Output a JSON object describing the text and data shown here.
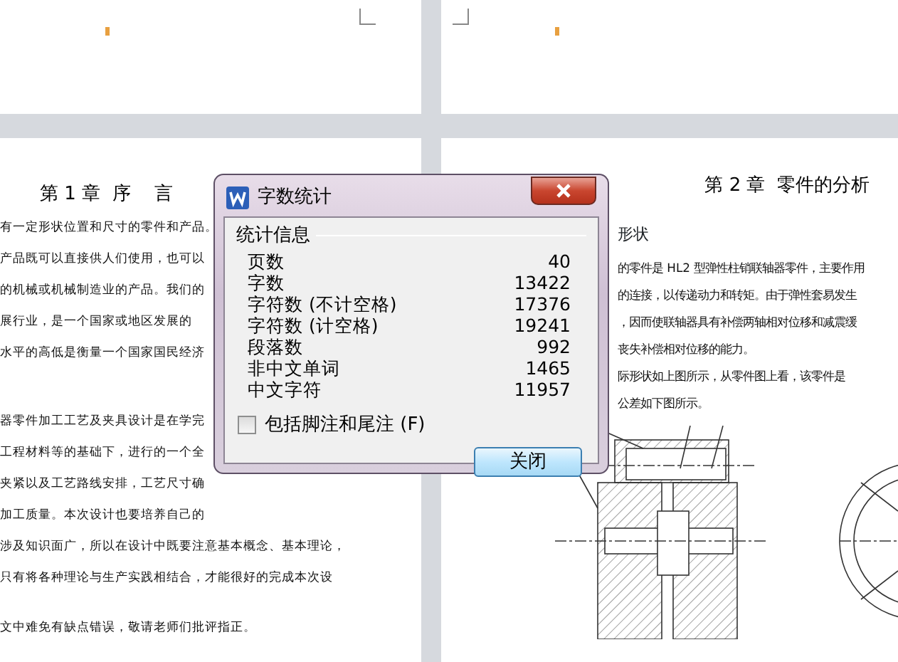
{
  "document": {
    "left_page": {
      "heading": "第 1 章  序    言",
      "paragraphs": [
        [
          "有一定形状位置和尺寸的零件和产品。",
          "产品既可以直接供人们使用，也可以",
          "的机械或机械制造业的产品。我们的",
          "展行业，是一个国家或地区发展的",
          "水平的高低是衡量一个国家国民经济"
        ],
        [
          "器零件加工工艺及夹具设计是在学完",
          "工程材料等的基础下，进行的一个全",
          "夹紧以及工艺路线安排，工艺尺寸确",
          "加工质量。本次设计也要培养自己的",
          "涉及知识面广，所以在设计中既要注意基本概念、基本理论，",
          "只有将各种理论与生产实践相结合，才能很好的完成本次设"
        ],
        [
          "文中难免有缺点错误，敬请老师们批评指正。"
        ]
      ]
    },
    "right_page": {
      "heading": "第 2 章  零件的分析",
      "subheading": "形状",
      "paragraphs": [
        [
          "的零件是 HL2 型弹性柱销联轴器零件，主要作用",
          "的连接，以传递动力和转矩。由于弹性套易发生",
          "，因而使联轴器具有补偿两轴相对位移和减震缓",
          "丧失补偿相对位移的能力。"
        ],
        [
          "际形状如上图所示，从零件图上看，该零件是",
          "公差如下图所示。"
        ]
      ]
    }
  },
  "dialog": {
    "title": "字数统计",
    "section_title": "统计信息",
    "stats": [
      {
        "label": "页数",
        "value": "40"
      },
      {
        "label": "字数",
        "value": "13422"
      },
      {
        "label": "字符数 (不计空格)",
        "value": "17376"
      },
      {
        "label": "字符数 (计空格)",
        "value": "19241"
      },
      {
        "label": "段落数",
        "value": "992"
      },
      {
        "label": "非中文单词",
        "value": "1465"
      },
      {
        "label": "中文字符",
        "value": "11957"
      }
    ],
    "checkbox": {
      "label": "包括脚注和尾注 (F)",
      "checked": false
    },
    "button": "关闭"
  }
}
